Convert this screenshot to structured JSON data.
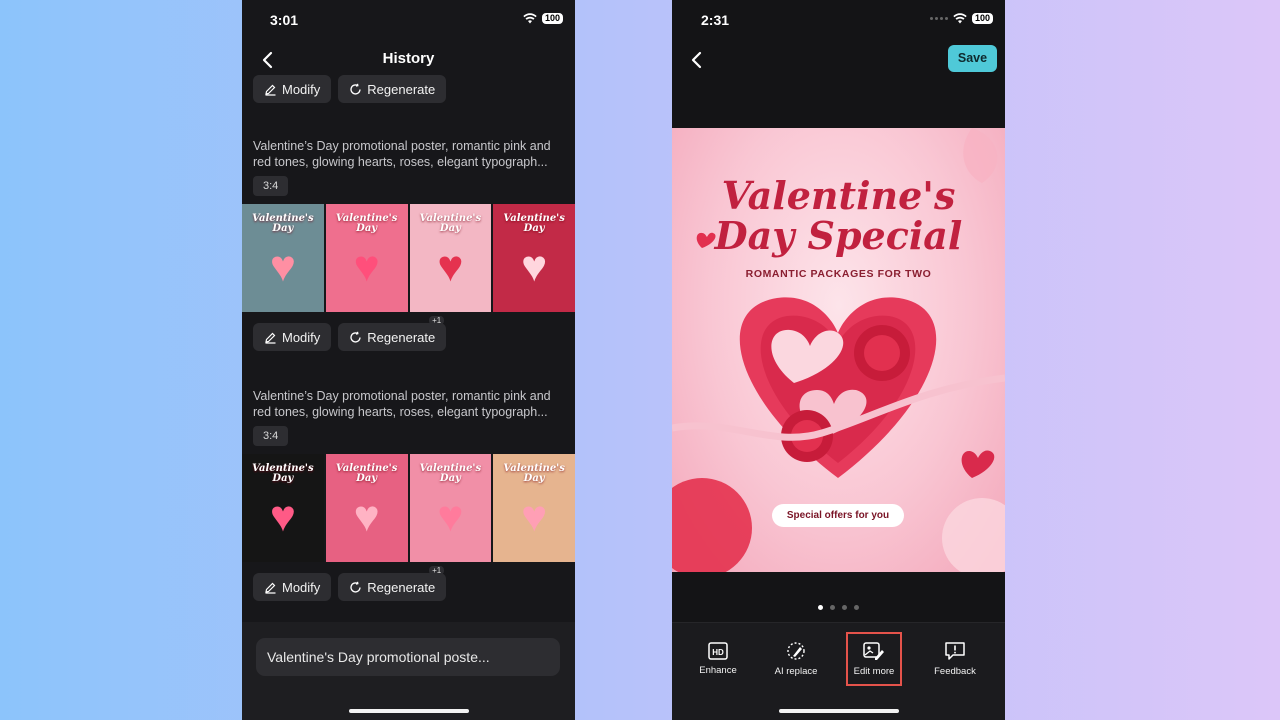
{
  "left_phone": {
    "status_time": "3:01",
    "battery": "100",
    "header_title": "History",
    "modify_label": "Modify",
    "regenerate_label": "Regenerate",
    "regen_badge": "+1",
    "groups": [
      {
        "prompt": "Valentine’s Day promotional poster, romantic pink and red tones, glowing hearts, roses, elegant typograph...",
        "ratio": "3:4",
        "thumbs": [
          {
            "title": "Valentine's Day",
            "bg": "#6d8d95",
            "heart": "#ff8fa3"
          },
          {
            "title": "Valentine's Day",
            "bg": "#ef6f8e",
            "heart": "#ff4f7b"
          },
          {
            "title": "Valentine's Day",
            "bg": "#f3b7c4",
            "heart": "#e5324f"
          },
          {
            "title": "Valentine's Day",
            "bg": "#c22a47",
            "heart": "#ffd6de"
          }
        ]
      },
      {
        "prompt": "Valentine’s Day promotional poster, romantic pink and red tones, glowing hearts, roses, elegant typograph...",
        "ratio": "3:4",
        "thumbs": [
          {
            "title": "Valentine's Day",
            "bg": "#151515",
            "heart": "#ff5a86"
          },
          {
            "title": "Valentine's Day",
            "bg": "#e76182",
            "heart": "#ffb3c4"
          },
          {
            "title": "Valentine's Day",
            "bg": "#f18fa7",
            "heart": "#ff7b9c"
          },
          {
            "title": "Valentine's Day",
            "bg": "#e6b48f",
            "heart": "#ff9fb5"
          }
        ]
      }
    ],
    "prompt_field": "Valentine's Day promotional poste..."
  },
  "right_phone": {
    "status_time": "2:31",
    "battery": "100",
    "save_label": "Save",
    "poster": {
      "title_line1": "Valentine's",
      "title_line2": "Day Special",
      "subtitle": "ROMANTIC PACKAGES FOR TWO",
      "offer": "Special offers for you"
    },
    "tools": [
      {
        "label": "Enhance",
        "icon": "hd-icon"
      },
      {
        "label": "AI replace",
        "icon": "ai-replace-icon"
      },
      {
        "label": "Edit more",
        "icon": "edit-image-icon"
      },
      {
        "label": "Feedback",
        "icon": "feedback-icon"
      }
    ]
  },
  "colors": {
    "accent_save": "#4fc9d8",
    "highlight_border": "#e5534b"
  }
}
